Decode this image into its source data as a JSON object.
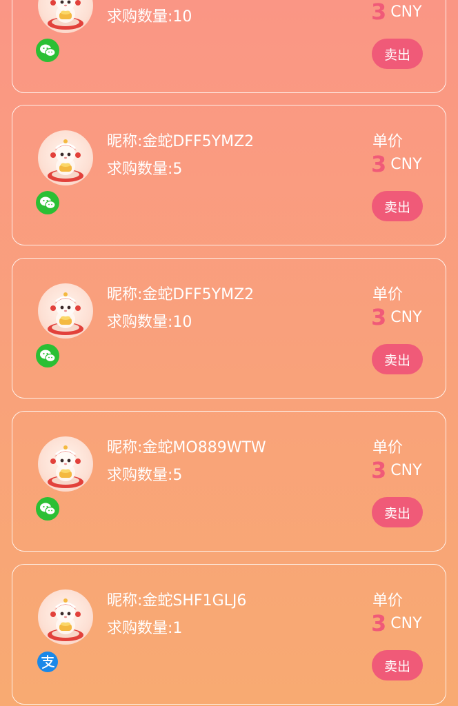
{
  "listings": [
    {
      "nickname": "",
      "quantity": "求购数量:10",
      "price_label": "",
      "price_value": "3",
      "currency": "CNY",
      "payment": "wechat-pay-icon",
      "action": "卖出"
    },
    {
      "nickname": "昵称:金蛇DFF5YMZ2",
      "quantity": "求购数量:5",
      "price_label": "单价",
      "price_value": "3",
      "currency": "CNY",
      "payment": "wechat-pay-icon",
      "action": "卖出"
    },
    {
      "nickname": "昵称:金蛇DFF5YMZ2",
      "quantity": "求购数量:10",
      "price_label": "单价",
      "price_value": "3",
      "currency": "CNY",
      "payment": "wechat-pay-icon",
      "action": "卖出"
    },
    {
      "nickname": "昵称:金蛇MO889WTW",
      "quantity": "求购数量:5",
      "price_label": "单价",
      "price_value": "3",
      "currency": "CNY",
      "payment": "wechat-pay-icon",
      "action": "卖出"
    },
    {
      "nickname": "昵称:金蛇SHF1GLJ6",
      "quantity": "求购数量:1",
      "price_label": "单价",
      "price_value": "3",
      "currency": "CNY",
      "payment": "alipay-icon",
      "action": "卖出"
    }
  ],
  "colors": {
    "background_top": "#fa9685",
    "background_bottom": "#f8aa72",
    "accent": "#f05a78",
    "wechat_green": "#2bbf34",
    "alipay_blue": "#1a88e8"
  }
}
